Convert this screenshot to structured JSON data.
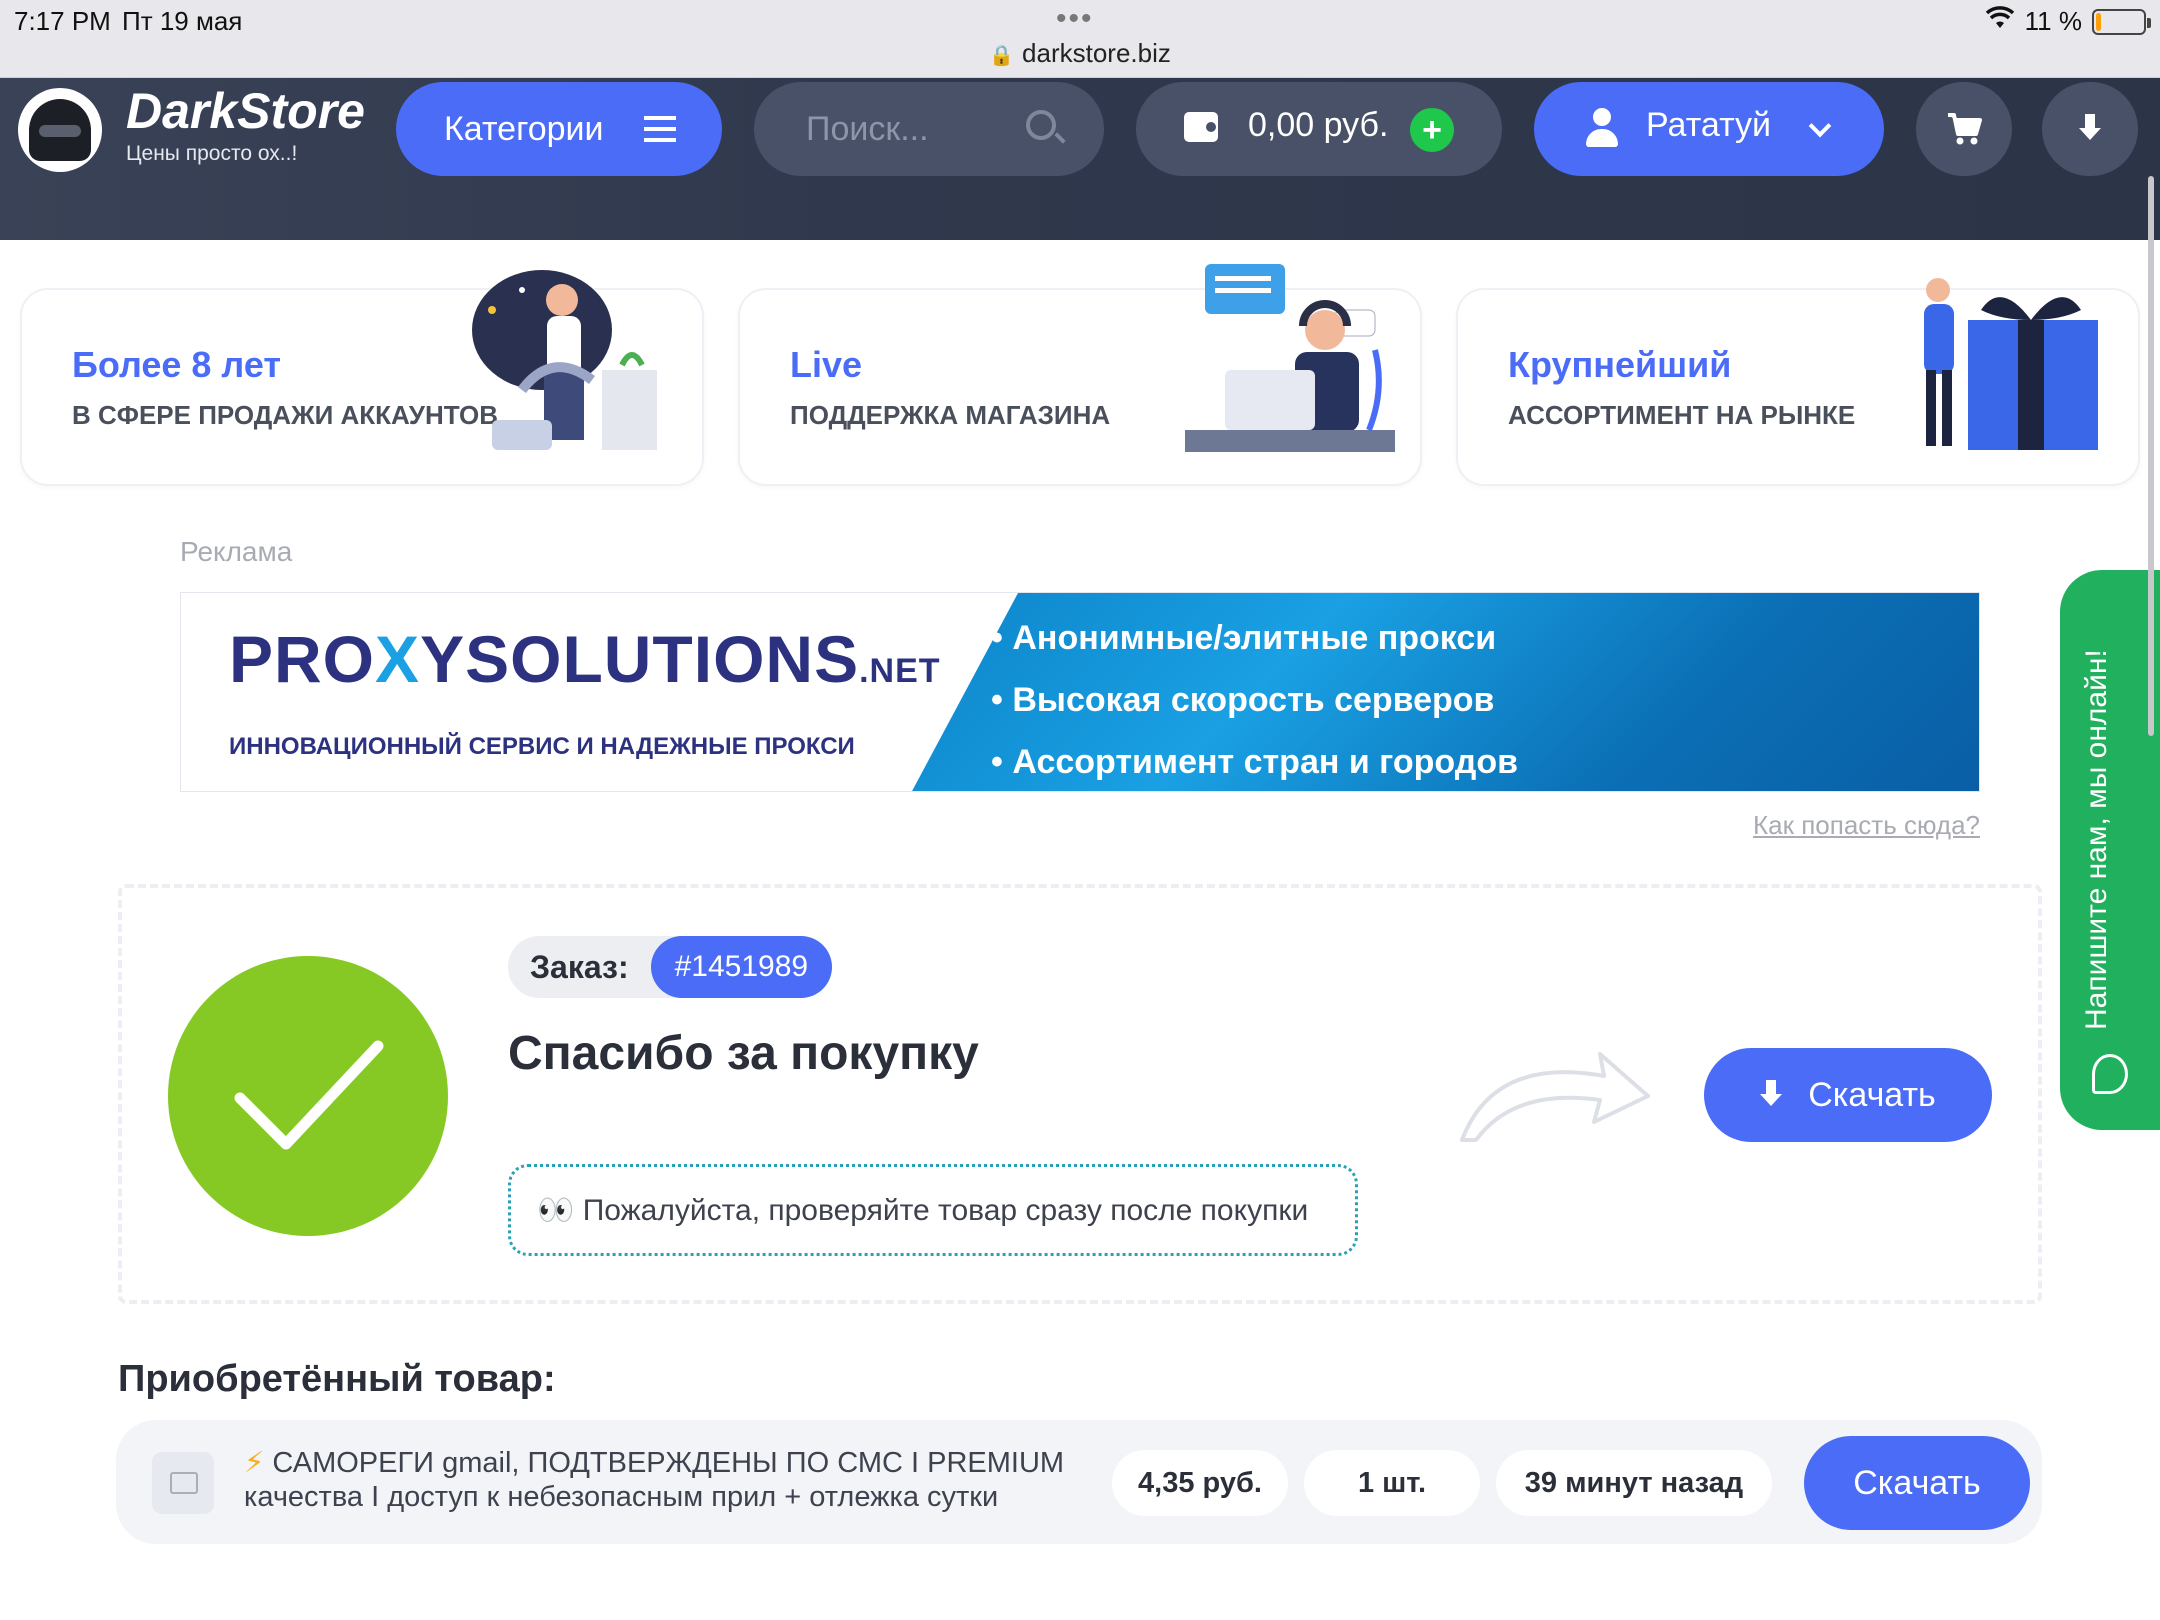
{
  "statusbar": {
    "time": "7:17 PM",
    "date": "Пт 19 мая",
    "url": "darkstore.biz",
    "battery": "11 %",
    "battery_level": 0.11
  },
  "header": {
    "brand": "DarkStore",
    "tagline": "Цены просто ох..!",
    "categories_label": "Категории",
    "search_placeholder": "Поиск...",
    "balance": "0,00 руб.",
    "user_name": "Рататуй"
  },
  "features": [
    {
      "title": "Более 8 лет",
      "subtitle": "В СФЕРЕ ПРОДАЖИ АККАУНТОВ"
    },
    {
      "title": "Live",
      "subtitle": "ПОДДЕРЖКА МАГАЗИНА"
    },
    {
      "title": "Крупнейший",
      "subtitle": "АССОРТИМЕНТ НА РЫНКЕ"
    }
  ],
  "ad": {
    "label": "Реклама",
    "logo_pre": "PRO",
    "logo_x": "X",
    "logo_post": "YSOLUTIONS",
    "logo_net": ".NET",
    "slogan": "ИННОВАЦИОННЫЙ СЕРВИС И НАДЕЖНЫЕ ПРОКСИ",
    "bullets": [
      "• Анонимные/элитные прокси",
      "• Высокая скорость серверов",
      "• Ассортимент стран и городов"
    ],
    "link": "Как попасть сюда?"
  },
  "order": {
    "label": "Заказ:",
    "number": "#1451989",
    "thanks": "Спасибо за покупку",
    "notice": "👀 Пожалуйста, проверяйте товар сразу после покупки",
    "download_label": "Скачать"
  },
  "purchased": {
    "heading": "Приобретённый товар:",
    "bolt": "⚡",
    "name": " САМОРЕГИ gmail, ПОДТВЕРЖДЕНЫ ПО СМС I PREMIUM качества I доступ к небезопасным прил + отлежка сутки",
    "price": "4,35 руб.",
    "qty": "1 шт.",
    "time": "39 минут назад",
    "download_label": "Скачать"
  },
  "chat": {
    "label": "Напишите нам, мы онлайн!"
  },
  "colors": {
    "accent": "#4a6cf7",
    "success": "#86c924",
    "header_bg": "#30384d",
    "chat": "#21b05e"
  }
}
